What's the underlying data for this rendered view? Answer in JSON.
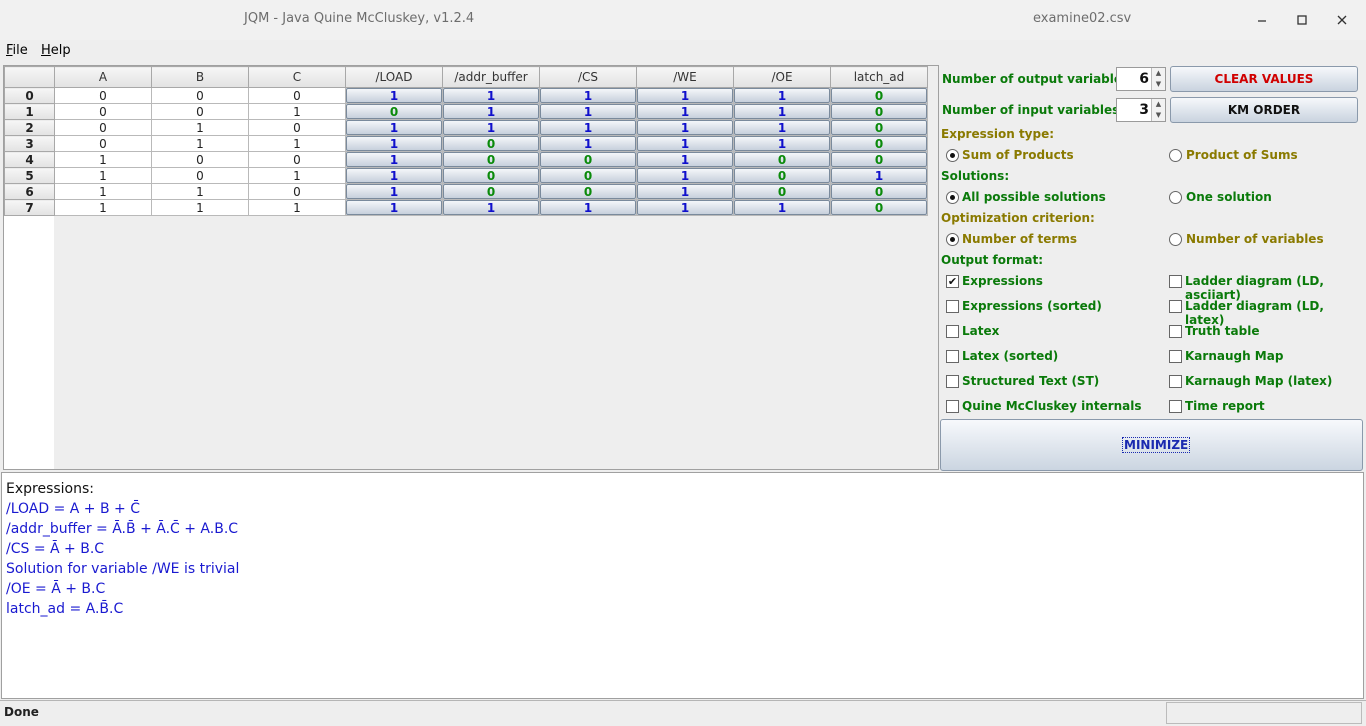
{
  "window": {
    "title": "JQM - Java Quine McCluskey, v1.2.4",
    "file": "examine02.csv",
    "controls": [
      "minimize-icon",
      "maximize-icon",
      "close-icon"
    ]
  },
  "menu": {
    "file": "File",
    "help": "Help",
    "file_mnemonic": "F",
    "file_rest": "ile",
    "help_mnemonic": "H",
    "help_rest": "elp"
  },
  "table": {
    "corner": "",
    "input_columns": [
      "A",
      "B",
      "C"
    ],
    "output_columns": [
      "/LOAD",
      "/addr_buffer",
      "/CS",
      "/WE",
      "/OE",
      "latch_ad"
    ],
    "rows": [
      {
        "index": "0",
        "inputs": [
          "0",
          "0",
          "0"
        ],
        "outputs": [
          "1",
          "1",
          "1",
          "1",
          "1",
          "0"
        ]
      },
      {
        "index": "1",
        "inputs": [
          "0",
          "0",
          "1"
        ],
        "outputs": [
          "0",
          "1",
          "1",
          "1",
          "1",
          "0"
        ]
      },
      {
        "index": "2",
        "inputs": [
          "0",
          "1",
          "0"
        ],
        "outputs": [
          "1",
          "1",
          "1",
          "1",
          "1",
          "0"
        ]
      },
      {
        "index": "3",
        "inputs": [
          "0",
          "1",
          "1"
        ],
        "outputs": [
          "1",
          "0",
          "1",
          "1",
          "1",
          "0"
        ]
      },
      {
        "index": "4",
        "inputs": [
          "1",
          "0",
          "0"
        ],
        "outputs": [
          "1",
          "0",
          "0",
          "1",
          "0",
          "0"
        ]
      },
      {
        "index": "5",
        "inputs": [
          "1",
          "0",
          "1"
        ],
        "outputs": [
          "1",
          "0",
          "0",
          "1",
          "0",
          "1"
        ]
      },
      {
        "index": "6",
        "inputs": [
          "1",
          "1",
          "0"
        ],
        "outputs": [
          "1",
          "0",
          "0",
          "1",
          "0",
          "0"
        ]
      },
      {
        "index": "7",
        "inputs": [
          "1",
          "1",
          "1"
        ],
        "outputs": [
          "1",
          "1",
          "1",
          "1",
          "1",
          "0"
        ]
      }
    ]
  },
  "options": {
    "num_outputs_label": "Number of output variables:",
    "num_outputs_value": "6",
    "num_inputs_label": "Number  of  input  variables:",
    "num_inputs_value": "3",
    "clear_button": "CLEAR VALUES",
    "km_button": "KM ORDER",
    "expr_type_label": "Expression type:",
    "expr_type_options": [
      "Sum of Products",
      "Product of Sums"
    ],
    "expr_type_selected": 0,
    "solutions_label": "Solutions:",
    "solutions_options": [
      "All possible solutions",
      "One solution"
    ],
    "solutions_selected": 0,
    "opt_criterion_label": "Optimization criterion:",
    "opt_criterion_options": [
      "Number of terms",
      "Number of variables"
    ],
    "opt_criterion_selected": 0,
    "output_format_label": "Output format:",
    "formats": [
      {
        "label": "Expressions",
        "checked": true
      },
      {
        "label": "Ladder diagram (LD, asciiart)",
        "checked": false
      },
      {
        "label": "Expressions (sorted)",
        "checked": false
      },
      {
        "label": "Ladder diagram (LD, latex)",
        "checked": false
      },
      {
        "label": "Latex",
        "checked": false
      },
      {
        "label": "Truth table",
        "checked": false
      },
      {
        "label": "Latex (sorted)",
        "checked": false
      },
      {
        "label": "Karnaugh Map",
        "checked": false
      },
      {
        "label": "Structured Text (ST)",
        "checked": false
      },
      {
        "label": "Karnaugh Map (latex)",
        "checked": false
      },
      {
        "label": "Quine McCluskey internals",
        "checked": false
      },
      {
        "label": "Time report",
        "checked": false
      }
    ],
    "minimize_button": "MINIMIZE",
    "check_mark": "✔"
  },
  "output": {
    "header": "Expressions:",
    "lines": [
      "/LOAD = A + B + C̄",
      "/addr_buffer = Ā.B̄ + Ā.C̄ + A.B.C",
      "/CS = Ā + B.C",
      "Solution for variable /WE is trivial",
      "/OE = Ā + B.C",
      "latch_ad = A.B̄.C"
    ]
  },
  "status": {
    "text": "Done"
  }
}
